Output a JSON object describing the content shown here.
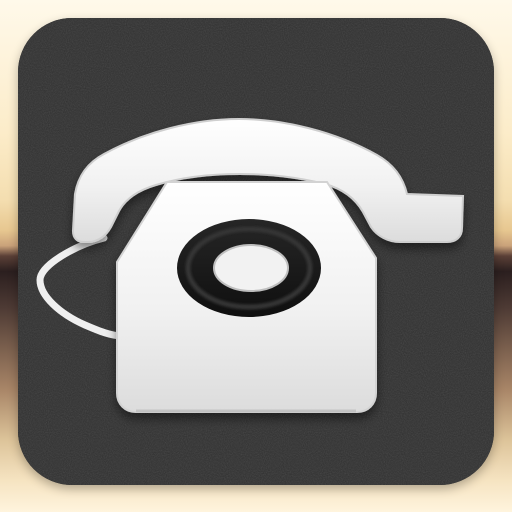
{
  "icon": {
    "symbol": "telephone-icon",
    "style": "rotary desk telephone"
  },
  "colors": {
    "background_light": "#fcefd2",
    "background_dark": "#2b1f1f",
    "tile": "#2f2f2f",
    "phone": "#f2f2f2",
    "dial": "#171717"
  }
}
